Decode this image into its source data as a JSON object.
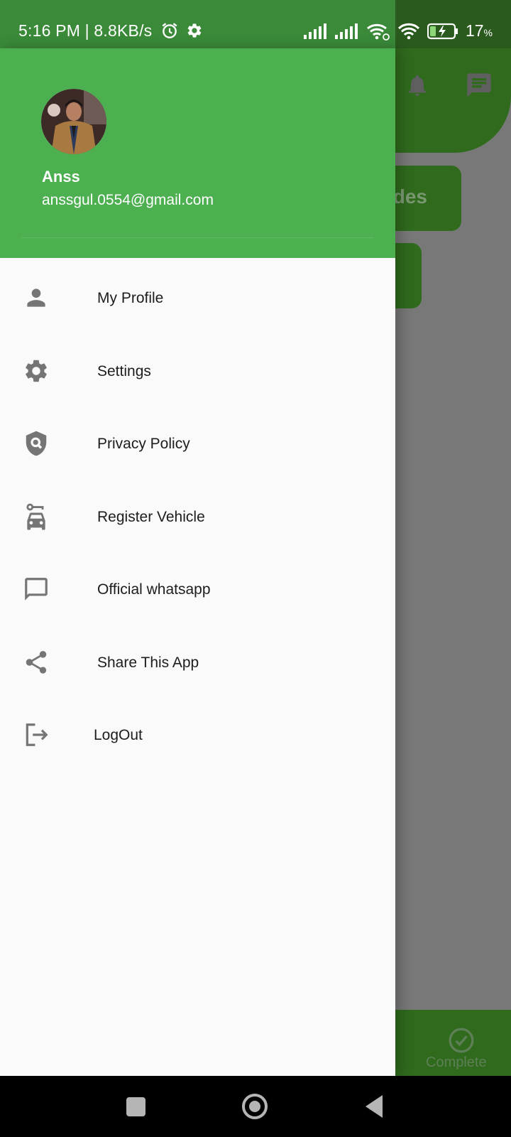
{
  "status_bar": {
    "time_speed": "5:16 PM | 8.8KB/s",
    "battery_value": "17",
    "battery_unit": "%",
    "icons": [
      "alarm-icon",
      "gear-icon",
      "signal-icon",
      "signal-icon",
      "wifi-link-icon",
      "wifi-icon",
      "battery-charging-icon"
    ]
  },
  "background_app": {
    "card_text": "des",
    "bottom_nav_label": "Complete",
    "icons": [
      "bell-icon",
      "chat-icon",
      "check-circle-icon"
    ]
  },
  "drawer": {
    "user": {
      "name": "Anss",
      "email": "anssgul.0554@gmail.com"
    },
    "menu": [
      {
        "label": "My Profile",
        "icon": "person-icon"
      },
      {
        "label": "Settings",
        "icon": "gear-icon"
      },
      {
        "label": "Privacy Policy",
        "icon": "shield-icon"
      },
      {
        "label": "Register Vehicle",
        "icon": "car-key-icon"
      },
      {
        "label": "Official whatsapp",
        "icon": "message-icon"
      },
      {
        "label": "Share This App",
        "icon": "share-icon"
      },
      {
        "label": "LogOut",
        "icon": "logout-icon"
      }
    ]
  },
  "colors": {
    "drawer_header": "#4caf50",
    "status_bar": "#3a8a39",
    "icon_gray": "#757575",
    "background_dim": "#787878",
    "background_green": "#2f6a1d"
  }
}
